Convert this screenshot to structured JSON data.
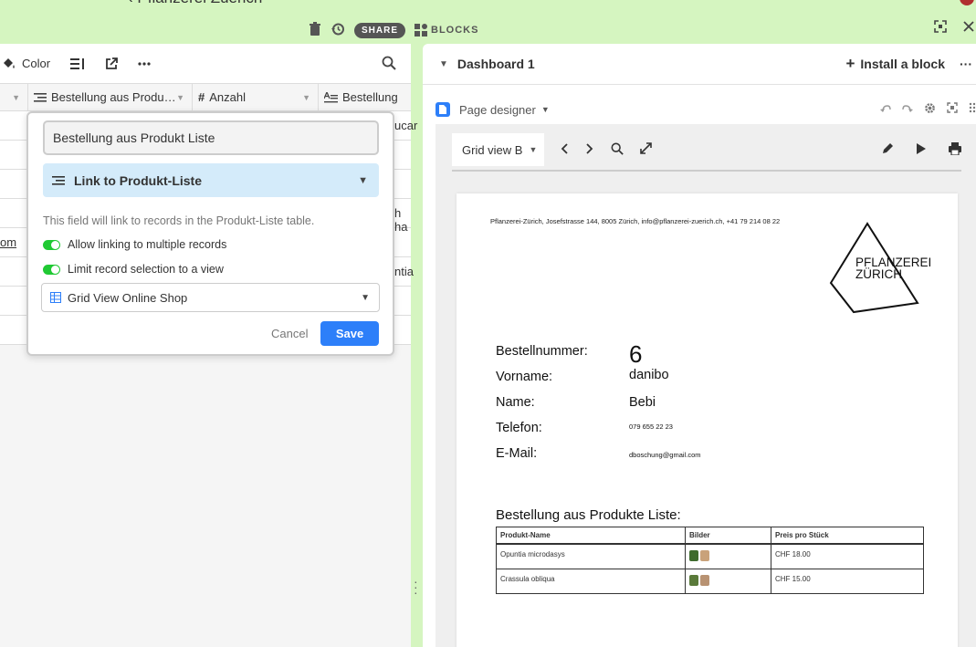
{
  "topbar": {
    "base_title": "‹ Pflanzerei Zuerich",
    "share_label": "SHARE",
    "blocks_label": "BLOCKS"
  },
  "view_toolbar": {
    "color_label": "Color"
  },
  "columns": [
    {
      "label": "Bestellung aus Produ…"
    },
    {
      "label": "Anzahl"
    },
    {
      "label": "Bestellung"
    }
  ],
  "row_fragments": {
    "r1": "ucar",
    "r4": "h ha",
    "r5": "om",
    "r6": "ntia"
  },
  "field_popup": {
    "field_name": "Bestellung aus Produkt Liste",
    "field_type": "Link to Produkt-Liste",
    "description": "This field will link to records in the Produkt-Liste table.",
    "option_multiple": "Allow linking to multiple records",
    "option_limit_view": "Limit record selection to a view",
    "selected_view": "Grid View Online Shop",
    "cancel_label": "Cancel",
    "save_label": "Save"
  },
  "dashboard": {
    "title": "Dashboard 1",
    "install_label": "Install a block",
    "block_name": "Page designer",
    "view_picker": "Grid view B"
  },
  "page": {
    "header_line": "Pflanzerei-Zürich, Josefstrasse 144, 8005 Zürich, info@pflanzerei-zuerich.ch,  +41 79 214 08 22",
    "logo_line1": "PFLANZEREI",
    "logo_line2": "ZÜRICH",
    "fields": [
      {
        "label": "Bestellnummer:",
        "value": "6"
      },
      {
        "label": "Vorname:",
        "value": "danibo"
      },
      {
        "label": "Name:",
        "value": "Bebi"
      },
      {
        "label": "Telefon:",
        "value": "079 655 22 23"
      },
      {
        "label": "E-Mail:",
        "value": "dboschung@gmail.com"
      }
    ],
    "section_title": "Bestellung aus Produkte Liste:",
    "table_headers": [
      "Produkt-Name",
      "Bilder",
      "Preis pro Stück"
    ],
    "table_rows": [
      {
        "name": "Opuntia microdasys",
        "price": "CHF 18.00"
      },
      {
        "name": "Crassula obliqua",
        "price": "CHF 15.00"
      }
    ]
  },
  "colors": {
    "app_green": "#d5f5c0",
    "primary_blue": "#2d7ff9",
    "toggle_green": "#20c933",
    "link_type_bg": "#d4ebfa"
  }
}
